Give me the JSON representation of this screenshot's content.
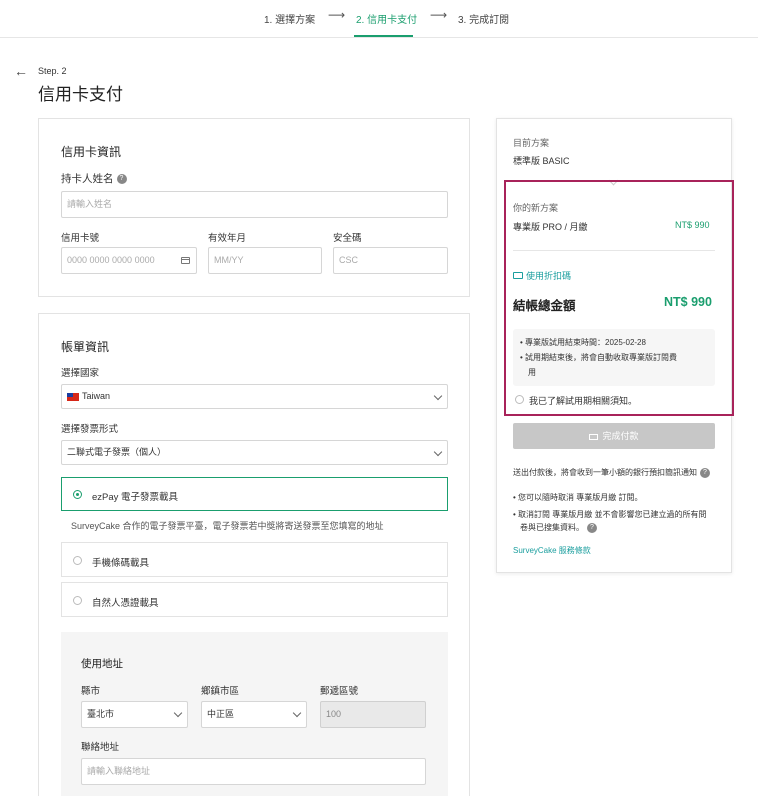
{
  "stepper": {
    "steps": [
      {
        "label": "1. 選擇方案"
      },
      {
        "label": "2. 信用卡支付"
      },
      {
        "label": "3. 完成訂閱"
      }
    ],
    "arrow": "⟶",
    "active_color": "#1a9e6e"
  },
  "header": {
    "back_icon": "←",
    "step": "Step. 2",
    "title": "信用卡支付"
  },
  "card_info": {
    "title": "信用卡資訊",
    "holder_label": "持卡人姓名",
    "holder_placeholder": "請輸入姓名",
    "number_label": "信用卡號",
    "number_placeholder": "0000 0000 0000 0000",
    "expiry_label": "有效年月",
    "expiry_placeholder": "MM/YY",
    "cvc_label": "安全碼",
    "cvc_placeholder": "CSC"
  },
  "billing": {
    "title": "帳單資訊",
    "country_label": "選擇國家",
    "country_value": "Taiwan",
    "invoice_label": "選擇發票形式",
    "invoice_value": "二聯式電子發票（個人）",
    "options": [
      {
        "label": "ezPay 電子發票載具",
        "selected": true
      },
      {
        "label": "手機條碼載具",
        "selected": false
      },
      {
        "label": "自然人憑證載具",
        "selected": false
      }
    ],
    "ezpay_note": "SurveyCake 合作的電子發票平臺，電子發票若中獎將寄送發票至您填寫的地址"
  },
  "address": {
    "title": "使用地址",
    "county_label": "縣市",
    "county_value": "臺北市",
    "district_label": "鄉鎮市區",
    "district_value": "中正區",
    "zip_label": "郵遞區號",
    "zip_value": "100",
    "addr_label": "聯絡地址",
    "addr_placeholder": "請輸入聯絡地址"
  },
  "summary": {
    "current_label": "目前方案",
    "current_plan": "標準版 BASIC",
    "new_label": "你的新方案",
    "new_plan": "專業版 PRO / 月繳",
    "new_price": "NT$ 990",
    "coupon": "使用折扣碼",
    "total_label": "結帳總金額",
    "total_value": "NT$ 990",
    "notice": [
      "專業版試用結束時間：2025-02-28",
      "試用期結束後，將會自動收取專業版訂閱費",
      "用"
    ],
    "agree": "我已了解試用期相關須知。",
    "pay_button": "完成付款",
    "bank_note": "送出付款後，將會收到一筆小額的銀行預扣簡訊通知",
    "bullets": [
      "您可以隨時取消 專業版月繳 訂閱。",
      "取消訂閱 專業版月繳 並不會影響您已建立過的所有問",
      "卷與已搜集資料。"
    ],
    "terms": "SurveyCake 服務條款",
    "highlight_color": "#a8235a"
  }
}
